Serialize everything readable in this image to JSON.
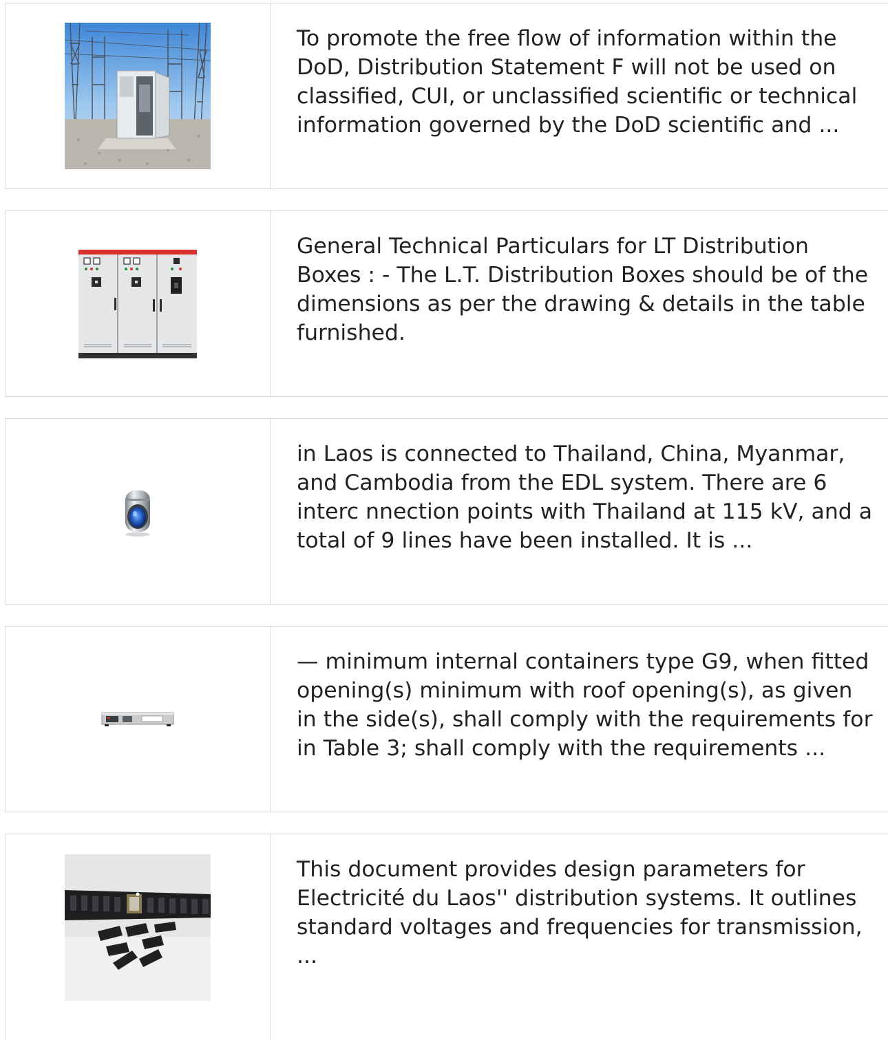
{
  "results": [
    {
      "image": "substation-outdoor-cabinet",
      "text": "To promote the free flow of information within the DoD, Distribution Statement F will not be used on classified, CUI, or unclassified scientific or technical information governed by the DoD scientific and ..."
    },
    {
      "image": "lt-distribution-box-panels",
      "text": "General Technical Particulars for LT Distribution Boxes : - The L.T. Distribution Boxes should be of the dimensions as per the drawing & details in the table furnished."
    },
    {
      "image": "metal-lens-connector",
      "text": "in Laos is connected to Thailand, China, Myanmar, and Cambodia from the EDL system. There are 6 interc nnection points with Thailand at 115 kV, and a total of 9 lines have been installed. It is ..."
    },
    {
      "image": "rack-mount-unit",
      "text": "— minimum internal containers type G9, when fitted opening(s) minimum with roof opening(s), as given in the side(s), shall comply with the requirements for in Table 3; shall comply with the requirements ..."
    },
    {
      "image": "black-plastic-clips",
      "text": "This document provides design parameters for Electricité du Laos'' distribution systems. It outlines standard voltages and frequencies for transmission, ..."
    }
  ]
}
